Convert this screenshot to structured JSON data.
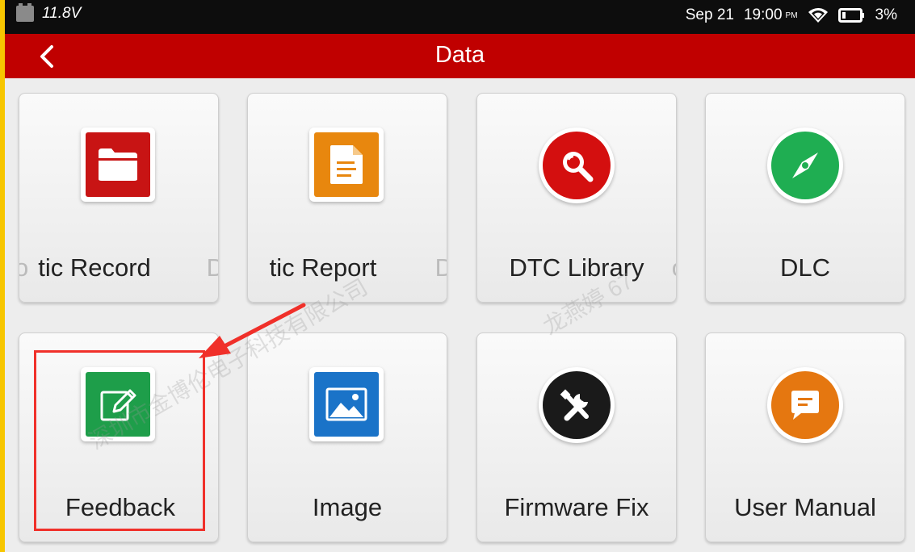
{
  "status_bar": {
    "voltage": "11.8V",
    "date": "Sep 21",
    "time": "19:00",
    "ampm": "PM",
    "battery_percent": "3%",
    "icons": [
      "car-battery-icon",
      "wifi-icon",
      "battery-icon"
    ]
  },
  "title_bar": {
    "title": "Data",
    "back_icon": "chevron-left-icon"
  },
  "tiles": [
    {
      "label": "tic Record",
      "ghost_left": "o",
      "ghost_right": "D",
      "icon": "folder-icon",
      "color": "#c81414"
    },
    {
      "label": "tic Report",
      "ghost_right": "D",
      "icon": "document-icon",
      "color": "#e8870e"
    },
    {
      "label": "DTC Library",
      "ghost_right": "o",
      "icon": "search-icon",
      "color": "#d40f0f"
    },
    {
      "label": "DLC",
      "icon": "compass-icon",
      "color": "#1fae52"
    },
    {
      "label": "Feedback",
      "icon": "edit-icon",
      "color": "#1e9e4a"
    },
    {
      "label": "Image",
      "icon": "image-icon",
      "color": "#1a73c8"
    },
    {
      "label": "Firmware Fix",
      "icon": "tools-icon",
      "color": "#1a1a1a"
    },
    {
      "label": "User Manual",
      "icon": "message-icon",
      "color": "#e57710"
    }
  ],
  "annotation": {
    "highlight_color": "#f0302a",
    "target": "Feedback"
  },
  "watermark": {
    "company": "深圳市金博伦电子科技有限公司",
    "name": "龙燕婷 67"
  },
  "colors": {
    "title_bar": "#c00000",
    "status_bar": "#0d0d0d",
    "frame": "#f7c600"
  }
}
